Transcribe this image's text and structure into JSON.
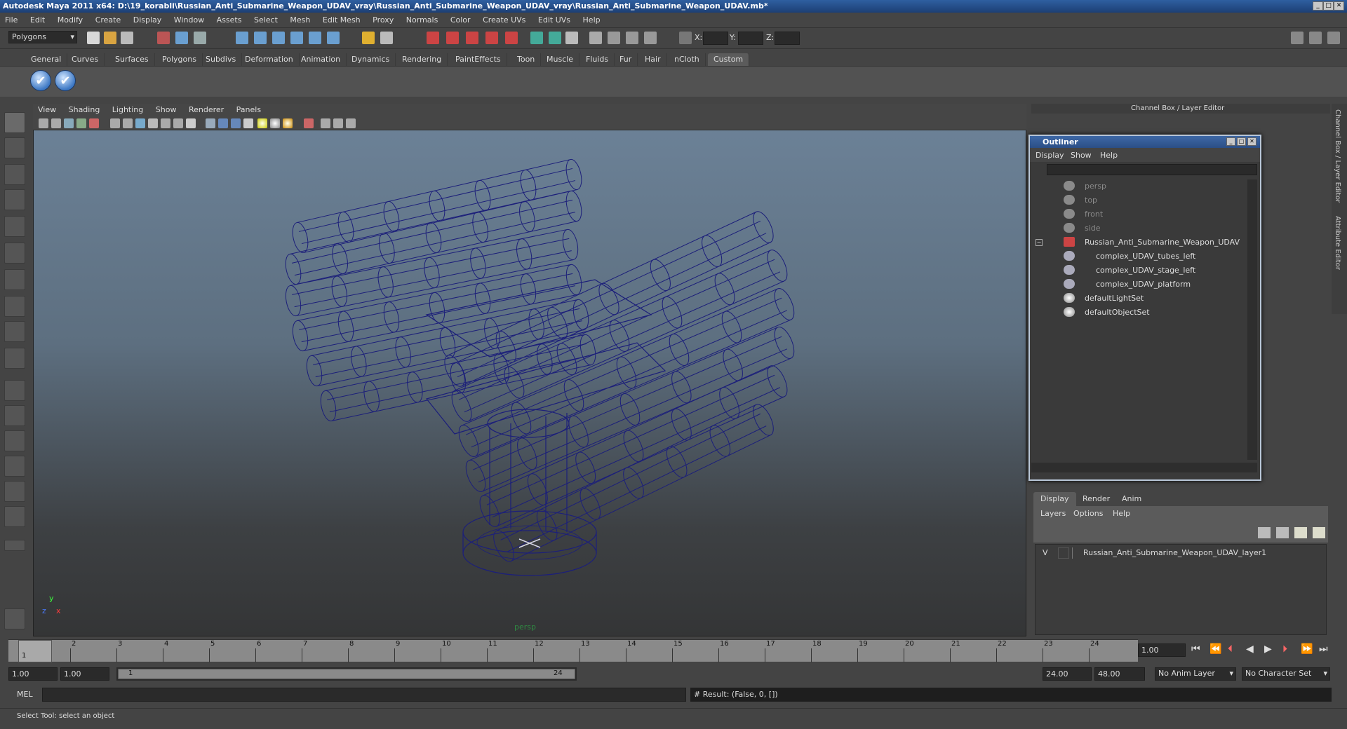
{
  "title": "Autodesk Maya 2011 x64: D:\\19_korabli\\Russian_Anti_Submarine_Weapon_UDAV_vray\\Russian_Anti_Submarine_Weapon_UDAV_vray\\Russian_Anti_Submarine_Weapon_UDAV.mb*",
  "menu": [
    "File",
    "Edit",
    "Modify",
    "Create",
    "Display",
    "Window",
    "Assets",
    "Select",
    "Mesh",
    "Edit Mesh",
    "Proxy",
    "Normals",
    "Color",
    "Create UVs",
    "Edit UVs",
    "Help"
  ],
  "toolbar": {
    "mode": "Polygons",
    "x_label": "X:",
    "y_label": "Y:",
    "z_label": "Z:"
  },
  "shelf_tabs": [
    "General",
    "Curves",
    "Surfaces",
    "Polygons",
    "Subdivs",
    "Deformation",
    "Animation",
    "Dynamics",
    "Rendering",
    "PaintEffects",
    "Toon",
    "Muscle",
    "Fluids",
    "Fur",
    "Hair",
    "nCloth",
    "Custom"
  ],
  "shelf_active": "Custom",
  "viewport": {
    "menu": [
      "View",
      "Shading",
      "Lighting",
      "Show",
      "Renderer",
      "Panels"
    ],
    "camera": "persp",
    "axis_x": "x",
    "axis_y": "y",
    "axis_z": "z"
  },
  "channel_box_title": "Channel Box / Layer Editor",
  "side_tabs": [
    "Channel Box / Layer Editor",
    "Attribute Editor"
  ],
  "outliner": {
    "title": "Outliner",
    "menu": [
      "Display",
      "Show",
      "Help"
    ],
    "items": [
      {
        "label": "persp",
        "dim": true
      },
      {
        "label": "top",
        "dim": true
      },
      {
        "label": "front",
        "dim": true
      },
      {
        "label": "side",
        "dim": true
      },
      {
        "label": "Russian_Anti_Submarine_Weapon_UDAV",
        "dim": false
      },
      {
        "label": "complex_UDAV_tubes_left",
        "dim": false
      },
      {
        "label": "complex_UDAV_stage_left",
        "dim": false
      },
      {
        "label": "complex_UDAV_platform",
        "dim": false
      },
      {
        "label": "defaultLightSet",
        "dim": false
      },
      {
        "label": "defaultObjectSet",
        "dim": false
      }
    ]
  },
  "layer_editor": {
    "tabs": [
      "Display",
      "Render",
      "Anim"
    ],
    "menu": [
      "Layers",
      "Options",
      "Help"
    ],
    "layer_visibility": "V",
    "layer_name": "Russian_Anti_Submarine_Weapon_UDAV_layer1"
  },
  "timeline": {
    "ticks": [
      "1",
      "2",
      "3",
      "4",
      "5",
      "6",
      "7",
      "8",
      "9",
      "10",
      "11",
      "12",
      "13",
      "14",
      "15",
      "16",
      "17",
      "18",
      "19",
      "20",
      "21",
      "22",
      "23",
      "24"
    ],
    "current_frame_marker": "1",
    "current_time": "1.00"
  },
  "range": {
    "start": "1.00",
    "playback_start": "1.00",
    "slider_start": "1",
    "slider_end": "24",
    "playback_end": "24.00",
    "end": "48.00",
    "anim_layer": "No Anim Layer",
    "character_set": "No Character Set"
  },
  "command": {
    "mode": "MEL",
    "result": "# Result: (False, 0, [])"
  },
  "status": "Select Tool: select an object",
  "colors": {
    "wireframe": "#1c1f7a",
    "accent": "#3e68a6"
  }
}
